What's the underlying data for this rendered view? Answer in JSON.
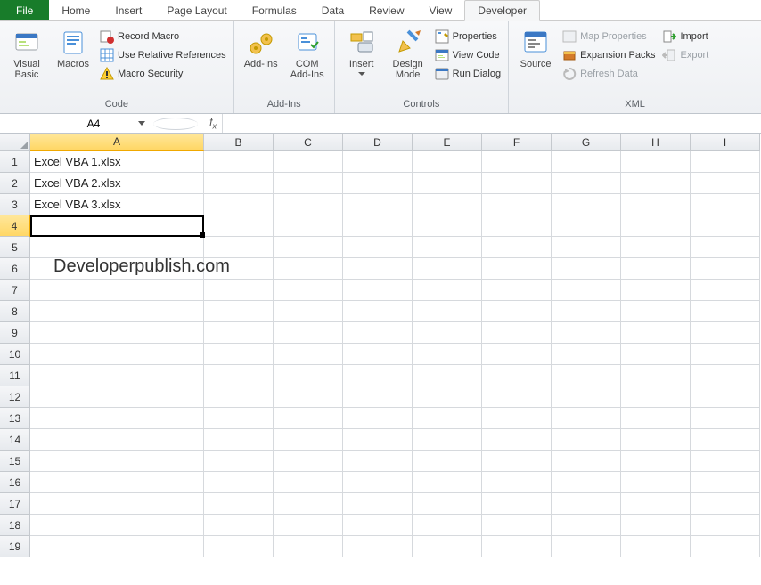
{
  "tabs": {
    "file": "File",
    "items": [
      "Home",
      "Insert",
      "Page Layout",
      "Formulas",
      "Data",
      "Review",
      "View",
      "Developer"
    ],
    "active": "Developer"
  },
  "ribbon": {
    "code": {
      "label": "Code",
      "visual_basic": "Visual\nBasic",
      "macros": "Macros",
      "record_macro": "Record Macro",
      "use_relative": "Use Relative References",
      "macro_security": "Macro Security"
    },
    "addins": {
      "label": "Add-Ins",
      "addins": "Add-Ins",
      "com_addins": "COM\nAdd-Ins"
    },
    "controls": {
      "label": "Controls",
      "insert": "Insert",
      "design_mode": "Design\nMode",
      "properties": "Properties",
      "view_code": "View Code",
      "run_dialog": "Run Dialog"
    },
    "xml": {
      "label": "XML",
      "source": "Source",
      "map_properties": "Map Properties",
      "expansion_packs": "Expansion Packs",
      "refresh_data": "Refresh Data",
      "import": "Import",
      "export": "Export"
    }
  },
  "namebox": "A4",
  "formula": "",
  "columns": [
    "A",
    "B",
    "C",
    "D",
    "E",
    "F",
    "G",
    "H",
    "I"
  ],
  "active_col": "A",
  "rows": [
    1,
    2,
    3,
    4,
    5,
    6,
    7,
    8,
    9,
    10,
    11,
    12,
    13,
    14,
    15,
    16,
    17,
    18,
    19
  ],
  "active_row": 4,
  "cells": {
    "A1": "Excel VBA 1.xlsx",
    "A2": "Excel VBA 2.xlsx",
    "A3": "Excel VBA 3.xlsx"
  },
  "watermark": "Developerpublish.com"
}
